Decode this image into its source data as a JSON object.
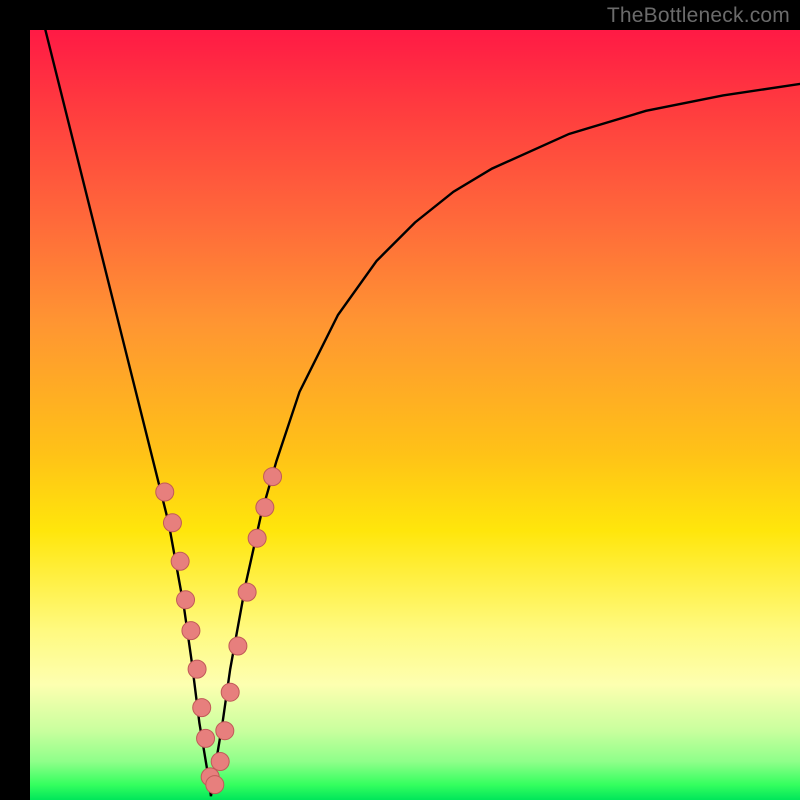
{
  "attribution": "TheBottleneck.com",
  "chart_data": {
    "type": "line",
    "title": "",
    "xlabel": "",
    "ylabel": "",
    "xlim": [
      0,
      100
    ],
    "ylim": [
      0,
      100
    ],
    "series": [
      {
        "name": "bottleneck-curve",
        "x": [
          2,
          4,
          6,
          8,
          10,
          12,
          14,
          16,
          18,
          20,
          21,
          22,
          23,
          23.5,
          24,
          25,
          26,
          28,
          30,
          32,
          35,
          40,
          45,
          50,
          55,
          60,
          70,
          80,
          90,
          100
        ],
        "y": [
          100,
          92,
          84,
          76,
          68,
          60,
          52,
          44,
          36,
          25,
          18,
          10,
          4,
          0.5,
          4,
          10,
          17,
          28,
          37,
          44,
          53,
          63,
          70,
          75,
          79,
          82,
          86.5,
          89.5,
          91.5,
          93
        ]
      }
    ],
    "points": {
      "name": "highlighted-points",
      "x": [
        17.5,
        18.5,
        19.5,
        20.2,
        20.9,
        21.7,
        22.3,
        22.8,
        23.4,
        24.0,
        24.7,
        25.3,
        26.0,
        27.0,
        28.2,
        29.5,
        30.5,
        31.5
      ],
      "y": [
        40,
        36,
        31,
        26,
        22,
        17,
        12,
        8,
        3,
        2,
        5,
        9,
        14,
        20,
        27,
        34,
        38,
        42
      ]
    },
    "colors": {
      "curve": "#000000",
      "points_fill": "#e77f7d",
      "points_stroke": "#c05a58",
      "gradient_top": "#ff1a45",
      "gradient_bottom": "#00e65a"
    }
  }
}
